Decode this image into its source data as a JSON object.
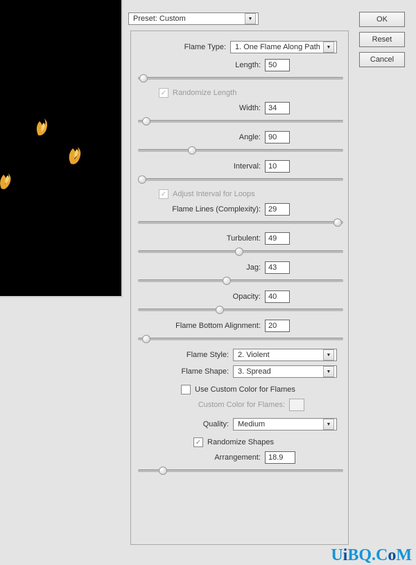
{
  "preset": {
    "label": "Preset: Custom"
  },
  "buttons": {
    "ok": "OK",
    "reset": "Reset",
    "cancel": "Cancel"
  },
  "fields": {
    "flame_type": {
      "label": "Flame Type:",
      "value": "1. One Flame Along Path"
    },
    "length": {
      "label": "Length:",
      "value": "50"
    },
    "randomize_length": {
      "label": "Randomize Length"
    },
    "width": {
      "label": "Width:",
      "value": "34"
    },
    "angle": {
      "label": "Angle:",
      "value": "90"
    },
    "interval": {
      "label": "Interval:",
      "value": "10"
    },
    "adjust_interval": {
      "label": "Adjust Interval for Loops"
    },
    "complexity": {
      "label": "Flame Lines (Complexity):",
      "value": "29"
    },
    "turbulent": {
      "label": "Turbulent:",
      "value": "49"
    },
    "jag": {
      "label": "Jag:",
      "value": "43"
    },
    "opacity": {
      "label": "Opacity:",
      "value": "40"
    },
    "bottom_align": {
      "label": "Flame Bottom Alignment:",
      "value": "20"
    },
    "flame_style": {
      "label": "Flame Style:",
      "value": "2. Violent"
    },
    "flame_shape": {
      "label": "Flame Shape:",
      "value": "3. Spread"
    },
    "use_custom_color": {
      "label": "Use Custom Color for Flames"
    },
    "custom_color": {
      "label": "Custom Color for Flames:"
    },
    "quality": {
      "label": "Quality:",
      "value": "Medium"
    },
    "randomize_shapes": {
      "label": "Randomize Shapes"
    },
    "arrangement": {
      "label": "Arrangement:",
      "value": "18.9"
    }
  },
  "watermark": "UiBQ.CoM"
}
